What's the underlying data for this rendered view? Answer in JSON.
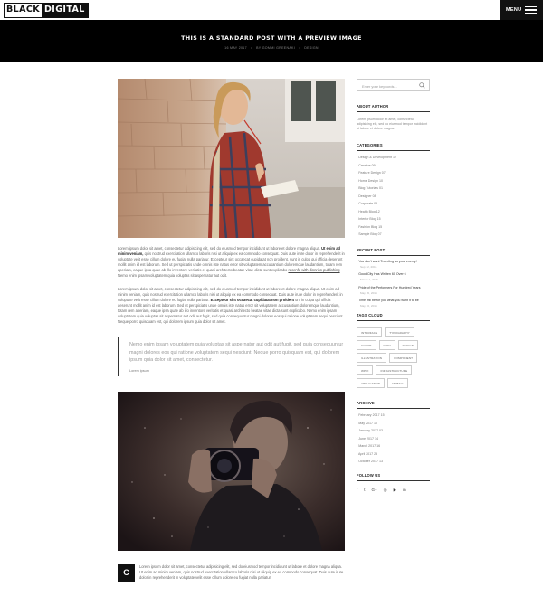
{
  "brand": {
    "word1": "BLACK",
    "word2": "DIGITAL"
  },
  "menu": {
    "label": "MENU"
  },
  "post": {
    "title": "THIS IS A STANDARD POST WITH A PREVIEW IMAGE",
    "date": "16 MAY 2017",
    "author": "BY GOMMI GREENAKI",
    "category": "DESIGN",
    "p1_a": "Lorem ipsum dolor sit amet, consectetur adipisicing elit, sed do eiusmod tempor incididunt ut labore et dolore magna aliqua.",
    "p1_b": "Ut enim ad minim veniam,",
    "p1_c": "quis nostrud exercitation ullamco laboris nisi ut aliquip ex ea commodo consequat. Duis aute irure dolor in reprehenderit in voluptate velit esse cillum dolore eu fugiat nulla pariatur. Excepteur sint occaecat cupidatat non proident, sunt in culpa qui officia deserunt mollit anim id est laborum. Sed ut perspiciatis unde omnis iste natus error sit voluptatem accusantium doloremque laudantium, totam rem aperiam, eaque ipsa quae ab illo inventore veritatis et quasi architecto beatae vitae dicta sunt explicabo",
    "p1_link": "recenfe with dinnrisn publishing",
    "p1_d": "Nemo enim ipsam voluptatem quia voluptas sit aspernatur aut odit.",
    "p2_a": "Lorem ipsum dolor sit amet, consectetur adipisicing elit, sed do eiusmod tempor incididunt ut labore et dolore magna aliqua. Ut enim ad minim veniam, quis nostrud exercitation ullamco laboris nisi ut aliquip ex ea commodo consequat. Duis aute irure dolor in reprehenderit in voluptate velit esse cillum dolore eu fugiat nulla pariatur.",
    "p2_b": "Excepteur sint occaecat cupidatat non proident",
    "p2_c": "unt in culpa qui officia deserunt mollit anim id est laborum. Sed ut perspiciatis unde omnis iste natus error sit voluptatem accusantium doloremque laudantium, totam rem aperiam, eaque ipsa quae ab illo inventore veritatis et quasi architecto beatae vitae dicta sunt explicabo. Nemo enim ipsam voluptatem quia voluptas sit aspernatur aut odit aut fugit, sed quia consequuntur magni dolores eos qui ratione voluptatem sequi nesciunt. Neque porro quisquam est, qui dolorem ipsum quia dolor sit amet.",
    "quote_text": "Nemo enim ipsam voluptatem quia voluptas sit aspernatur aut odit aut fugit, sed quia consequuntur magni dolores eos qui ratione voluptatem sequi nesciunt. Neque porro quisquam est, qui dolorem ipsum quia dolor sit amet, consectetur.",
    "quote_author": "Lorem ipsum",
    "dropcap": "C",
    "p3": "Lorem ipsum dolor sit amet, consectetur adipisicing elit, sed do eiusmod tempor incididunt ut labore et dolore magna aliqua. Ut enim ad minim veniam, quis nostrud exercitation ullamco laboris nisi ut aliquip ex ea commodo consequat. Duis aute irure dolor in reprehenderit in voluptate velit esse cillum dolore eu fugiat nulla pariatur."
  },
  "sidebar": {
    "search_placeholder": "Enter your keywords...",
    "about_title": "ABOUT AUTHOR",
    "about_text": "Lorem ipsum dolor sit amet, consectetur adipisicing elit, sed do eiusmod tempor incididunt ut labore et dolore magna.",
    "categories_title": "CATEGORIES",
    "categories": [
      "Design & Development 12",
      "Creative 09",
      "Feature Design 07",
      "Home Design 10",
      "Blog Tutorials 01",
      "Designer 08",
      "Corporate 05",
      "Health Blog 12",
      "Interior Blog 15",
      "Fashion Blog 15",
      "Sample Blog 07"
    ],
    "recent_title": "RECENT POST",
    "recent": [
      {
        "title": "You don't want Traveling as your enemy!",
        "date": "Sep 12, 2016"
      },
      {
        "title": "Good City Has Written 60 Over 6",
        "date": "March 1, 2016"
      },
      {
        "title": "Pride of the Performers For Hundred Years",
        "date": "May 20, 2016"
      },
      {
        "title": "Time will be for you what you want it to be",
        "date": "May 22, 2016"
      }
    ],
    "tags_title": "TAGS CLOUD",
    "tags": [
      "INTERFACE",
      "TYPOGRAPHY",
      "COLOR",
      "ICON",
      "DESIGN",
      "ILLUSTRATION",
      "COMPONENT",
      "WPUI",
      "INFRASTRUCTURE",
      "APPLICATION",
      "MOBILE"
    ],
    "archive_title": "ARCHIVE",
    "archive": [
      "February 2017 15",
      "May 2017 10",
      "January 2017 03",
      "June 2017 14",
      "March 2017 16",
      "April 2017 25",
      "October 2017 13"
    ],
    "follow_title": "FOLLOW US",
    "social": [
      "f",
      "t",
      "G+",
      "◎",
      "▶",
      "in"
    ]
  }
}
